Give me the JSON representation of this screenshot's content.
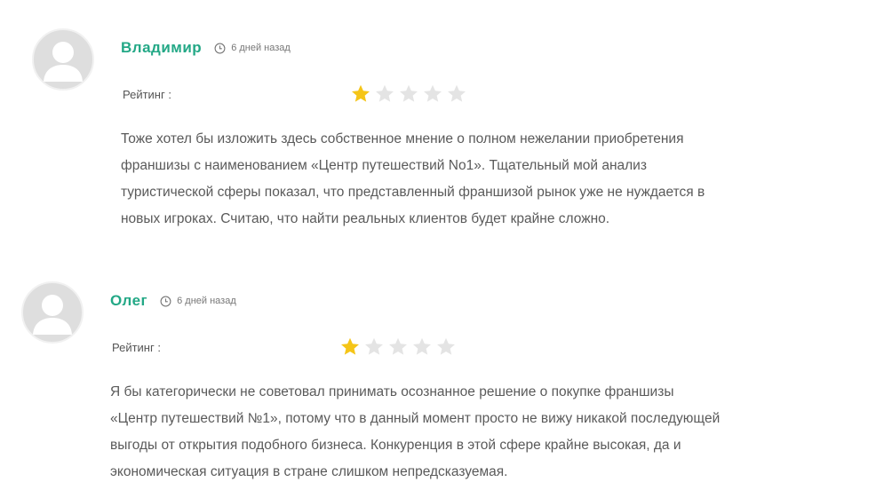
{
  "reviews": [
    {
      "author": "Владимир",
      "time": "6 дней назад",
      "rating_label": "Рейтинг :",
      "rating": 1,
      "max_rating": 5,
      "text_lines": [
        "Тоже хотел бы изложить здесь собственное мнение о полном нежелании приобретения",
        "франшизы с наименованием «Центр путешествий No1». Тщательный мой анализ",
        "туристической сферы показал, что представленный франшизой рынок уже не нуждается в",
        "новых игроках. Считаю, что найти реальных клиентов будет крайне сложно."
      ]
    },
    {
      "author": "Олег",
      "time": "6 дней назад",
      "rating_label": "Рейтинг :",
      "rating": 1,
      "max_rating": 5,
      "text_lines": [
        "Я бы категорически не советовал принимать осознанное решение о покупке франшизы",
        "«Центр путешествий №1», потому что в данный момент просто не вижу никакой последующей",
        "выгоды от открытия подобного бизнеса. Конкуренция в этой сфере крайне высокая, да и",
        "экономическая ситуация в стране слишком непредсказуемая."
      ]
    }
  ],
  "colors": {
    "author": "#23a886",
    "star_filled": "#f5c518",
    "star_empty": "#e4e4e4",
    "text": "#5a5a5a"
  },
  "icons": {
    "avatar": "user-silhouette-icon",
    "time": "clock-icon",
    "rating": "star-icon"
  }
}
